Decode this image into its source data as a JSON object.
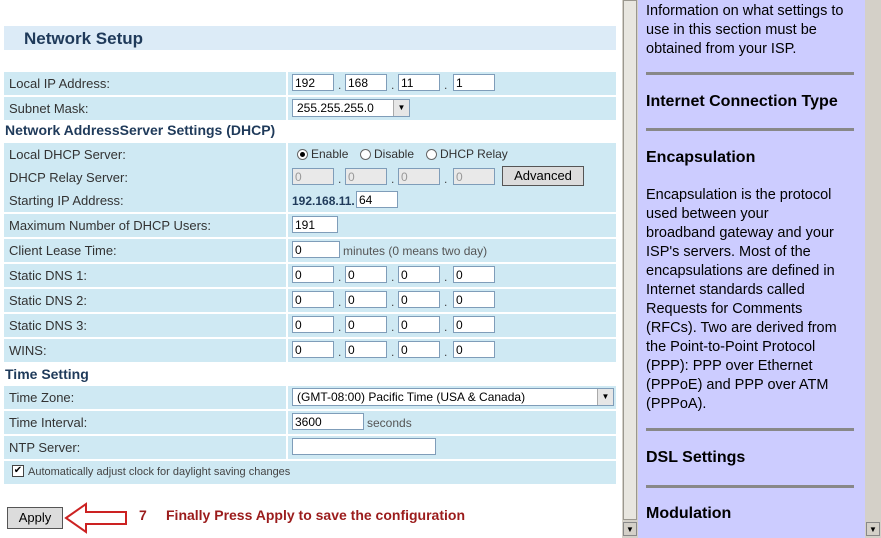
{
  "left": {
    "title": "Network Setup",
    "local_ip": {
      "label": "Local IP Address:",
      "octets": [
        "192",
        "168",
        "11",
        "1"
      ]
    },
    "subnet": {
      "label": "Subnet Mask:",
      "value": "255.255.255.0"
    },
    "dhcp_section": "Network AddressServer Settings (DHCP)",
    "dhcp_server": {
      "label": "Local DHCP Server:",
      "enable": "Enable",
      "disable": "Disable",
      "relay": "DHCP Relay",
      "selected": "Enable"
    },
    "dhcp_relay": {
      "label": "DHCP Relay Server:",
      "octets": [
        "0",
        "0",
        "0",
        "0"
      ],
      "advanced": "Advanced"
    },
    "start_ip": {
      "label": "Starting IP Address:",
      "prefix": "192.168.11.",
      "value": "64"
    },
    "max_users": {
      "label": "Maximum Number of DHCP Users:",
      "value": "191"
    },
    "lease": {
      "label": "Client Lease Time:",
      "value": "0",
      "suffix": "minutes (0 means two day)"
    },
    "dns1": {
      "label": "Static DNS 1:",
      "octets": [
        "0",
        "0",
        "0",
        "0"
      ]
    },
    "dns2": {
      "label": "Static DNS 2:",
      "octets": [
        "0",
        "0",
        "0",
        "0"
      ]
    },
    "dns3": {
      "label": "Static DNS 3:",
      "octets": [
        "0",
        "0",
        "0",
        "0"
      ]
    },
    "wins": {
      "label": "WINS:",
      "octets": [
        "0",
        "0",
        "0",
        "0"
      ]
    },
    "time_section": "Time Setting",
    "time_zone": {
      "label": "Time Zone:",
      "value": "(GMT-08:00) Pacific Time (USA & Canada)"
    },
    "time_interval": {
      "label": "Time Interval:",
      "value": "3600",
      "suffix": "seconds"
    },
    "ntp": {
      "label": "NTP Server:",
      "value": ""
    },
    "dst_label": "Automatically adjust clock for daylight saving changes",
    "apply": "Apply",
    "step_number": "7",
    "instruction": "Finally Press Apply to save the configuration"
  },
  "right": {
    "intro_lines": [
      "Information on what settings to",
      "use in this section must be",
      "obtained from your ISP."
    ],
    "h_connection": "Internet Connection Type",
    "h_encapsulation": "Encapsulation",
    "encap_lines": [
      "Encapsulation is the protocol",
      "used between your",
      "broadband gateway and your",
      "ISP's servers. Most of the",
      "encapsulations are defined in",
      "Internet standards called",
      "Requests for Comments",
      "(RFCs). Two are derived from",
      "the Point-to-Point Protocol",
      "(PPP): PPP over Ethernet",
      "(PPPoE) and PPP over ATM",
      "(PPPoA)."
    ],
    "h_dsl": "DSL Settings",
    "h_modulation": "Modulation"
  },
  "colors": {
    "cell": "#cfe9f3",
    "title_bar": "#dcebf7",
    "help_bg": "#ccccff",
    "annotation": "#9b1c1c"
  }
}
